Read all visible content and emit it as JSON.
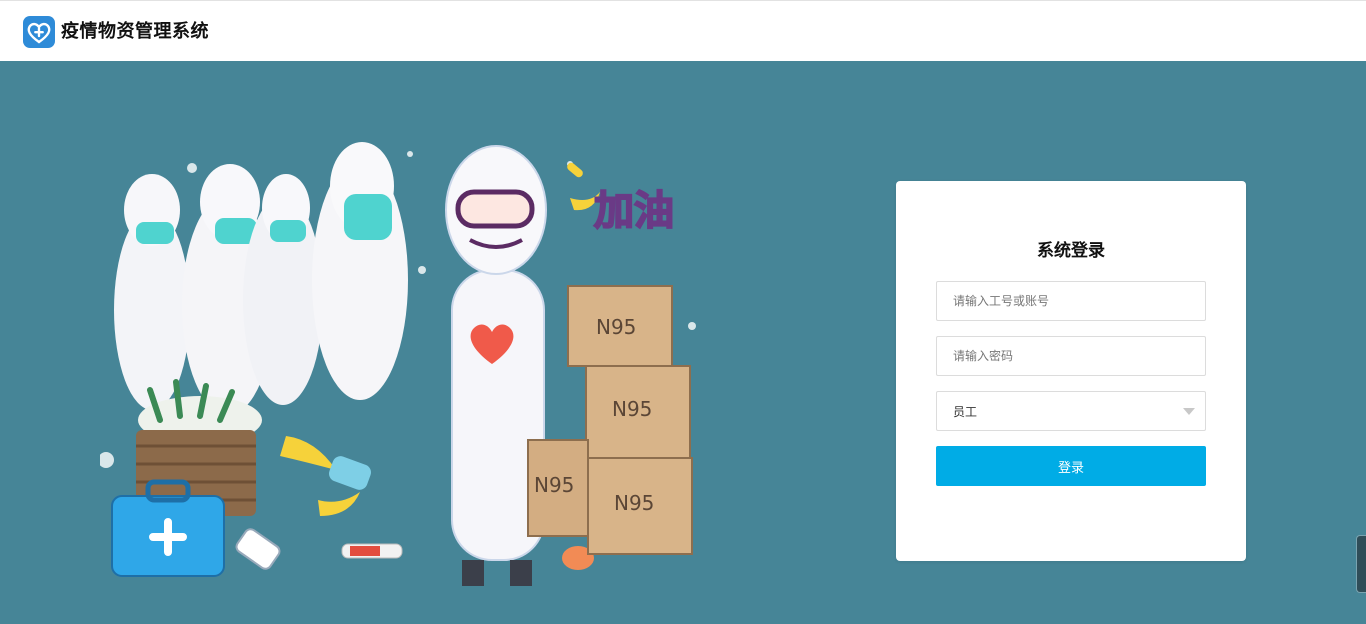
{
  "header": {
    "title": "疫情物资管理系统",
    "logo_icon": "heart-plus-icon"
  },
  "colors": {
    "background": "#468597",
    "primary_button": "#00ace6",
    "logo": "#2e8bd8"
  },
  "illustration": {
    "text": "加油",
    "box_label": "N95"
  },
  "login": {
    "title": "系统登录",
    "account_placeholder": "请输入工号或账号",
    "password_placeholder": "请输入密码",
    "role_selected": "员工",
    "submit_label": "登录"
  }
}
